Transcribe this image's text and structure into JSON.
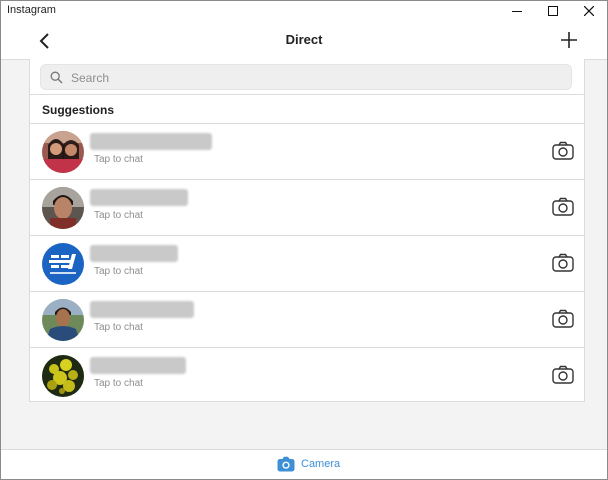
{
  "window": {
    "title": "Instagram"
  },
  "header": {
    "title": "Direct"
  },
  "search": {
    "placeholder": "Search"
  },
  "suggestions": {
    "title": "Suggestions",
    "items": [
      {
        "subtitle": "Tap to chat"
      },
      {
        "subtitle": "Tap to chat"
      },
      {
        "subtitle": "Tap to chat"
      },
      {
        "subtitle": "Tap to chat"
      },
      {
        "subtitle": "Tap to chat"
      }
    ]
  },
  "bottom": {
    "camera_label": "Camera"
  },
  "colors": {
    "accent": "#3d8fd6"
  }
}
